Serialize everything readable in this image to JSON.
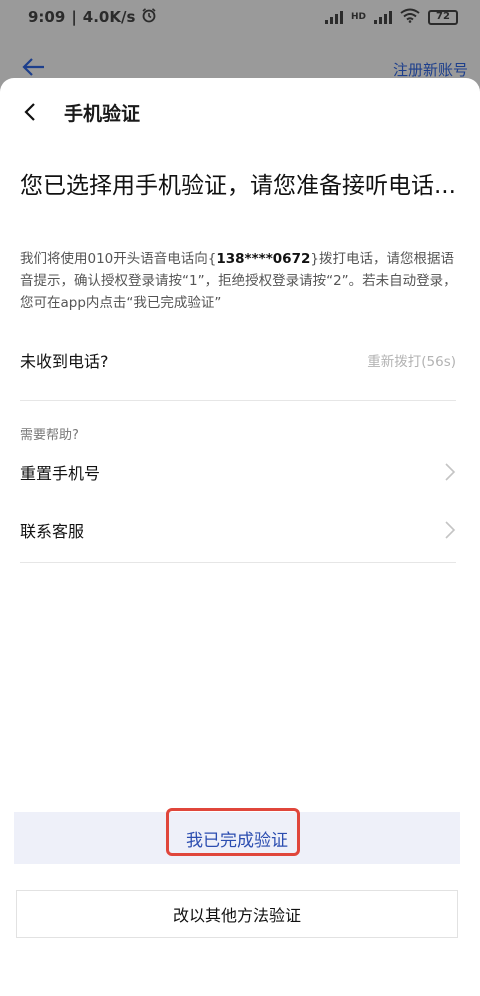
{
  "status_bar": {
    "time": "9:09",
    "network_speed": "4.0K/s",
    "separator": "|",
    "alarm_icon": "alarm-clock-icon",
    "network_type": "HD",
    "battery": "72"
  },
  "background": {
    "back_icon": "arrow-left-icon",
    "register_label": "注册新账号"
  },
  "sheet": {
    "title": "手机验证",
    "headline": "您已选择用手机验证，请您准备接听电话...",
    "description": {
      "part1": "我们将使用010开头语音电话向{",
      "phone": "138****0672",
      "part2": "}拨打电话，请您根据语音提示，确认授权登录请按“1”，拒绝授权登录请按“2”。若未自动登录，您可在app内点击“我已完成验证”"
    },
    "no_call_label": "未收到电话?",
    "redial_label": "重新拨打(56s)",
    "help_label": "需要帮助?",
    "help_items": [
      {
        "label": "重置手机号"
      },
      {
        "label": "联系客服"
      }
    ],
    "primary_button": "我已完成验证",
    "secondary_button": "改以其他方法验证"
  },
  "colors": {
    "accent": "#2b4db0",
    "highlight": "#e0463b",
    "primary_bg": "#eef0f9"
  }
}
